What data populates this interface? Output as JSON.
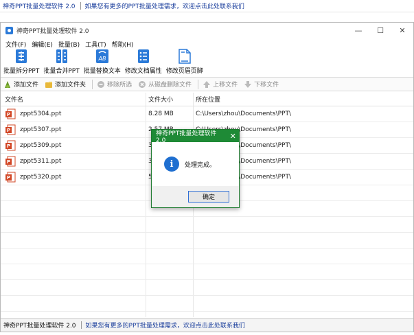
{
  "topbar": {
    "app_name": "神奇PPT批量处理软件 2.0",
    "promo": "如果您有更多的PPT批量处理需求，欢迎点击此处联系我们"
  },
  "window": {
    "title": "神奇PPT批量处理软件 2.0",
    "controls": {
      "minimize": "—",
      "maximize": "☐",
      "close": "✕"
    }
  },
  "menu": [
    "文件(F)",
    "编辑(E)",
    "批量(B)",
    "工具(T)",
    "帮助(H)"
  ],
  "toolbar": [
    {
      "label": "批量拆分PPT",
      "icon": "split-icon"
    },
    {
      "label": "批量合并PPT",
      "icon": "merge-icon"
    },
    {
      "label": "批量替换文本",
      "icon": "replace-text-icon"
    },
    {
      "label": "修改文档属性",
      "icon": "doc-properties-icon"
    },
    {
      "label": "修改页眉页脚",
      "icon": "header-footer-icon"
    }
  ],
  "filebar": {
    "add_file": "添加文件",
    "add_folder": "添加文件夹",
    "remove_selected": "移除所选",
    "delete_from_disk": "从磁盘删除文件",
    "move_up": "上移文件",
    "move_down": "下移文件"
  },
  "columns": {
    "name": "文件名",
    "size": "文件大小",
    "path": "所在位置"
  },
  "files": [
    {
      "name": "zppt5304.ppt",
      "size": "8.28 MB",
      "path": "C:\\Users\\zhou\\Documents\\PPT\\"
    },
    {
      "name": "zppt5307.ppt",
      "size": "2.57 MB",
      "path": "C:\\Users\\zhou\\Documents\\PPT\\"
    },
    {
      "name": "zppt5309.ppt",
      "size": "3",
      "path": "C:\\Users\\zhou\\Documents\\PPT\\"
    },
    {
      "name": "zppt5311.ppt",
      "size": "3",
      "path": "C:\\Users\\zhou\\Documents\\PPT\\"
    },
    {
      "name": "zppt5320.ppt",
      "size": "5",
      "path": "C:\\Users\\zhou\\Documents\\PPT\\"
    }
  ],
  "statusbar": {
    "app_name": "神奇PPT批量处理软件 2.0",
    "promo": "如果您有更多的PPT批量处理需求，欢迎点击此处联系我们"
  },
  "dialog": {
    "title": "神奇PPT批量处理软件 2.0",
    "close": "✕",
    "icon": "i",
    "message": "处理完成。",
    "ok": "确定"
  },
  "colors": {
    "accent_blue": "#2b7ad8",
    "dialog_green": "#1e8a36",
    "link_blue": "#1a3e9c",
    "ppt_red": "#d24726"
  }
}
